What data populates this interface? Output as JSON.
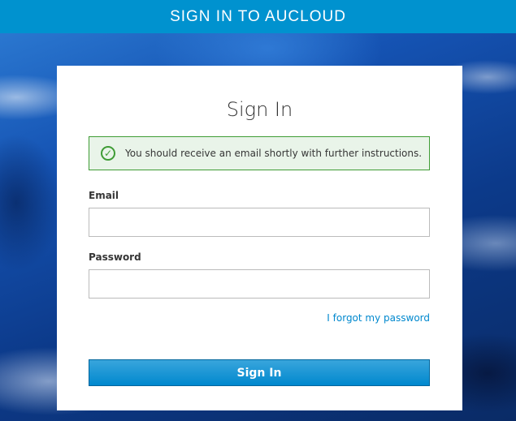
{
  "header": {
    "title": "SIGN IN TO AUCLOUD"
  },
  "card": {
    "title": "Sign In",
    "alert": {
      "icon": "check-circle-icon",
      "message": "You should receive an email shortly with further instructions."
    },
    "email": {
      "label": "Email",
      "value": ""
    },
    "password": {
      "label": "Password",
      "value": ""
    },
    "forgot_link": "I forgot my password",
    "submit_label": "Sign In"
  },
  "colors": {
    "header_bg": "#0092cf",
    "accent": "#0088ce",
    "success": "#3f9c35"
  }
}
